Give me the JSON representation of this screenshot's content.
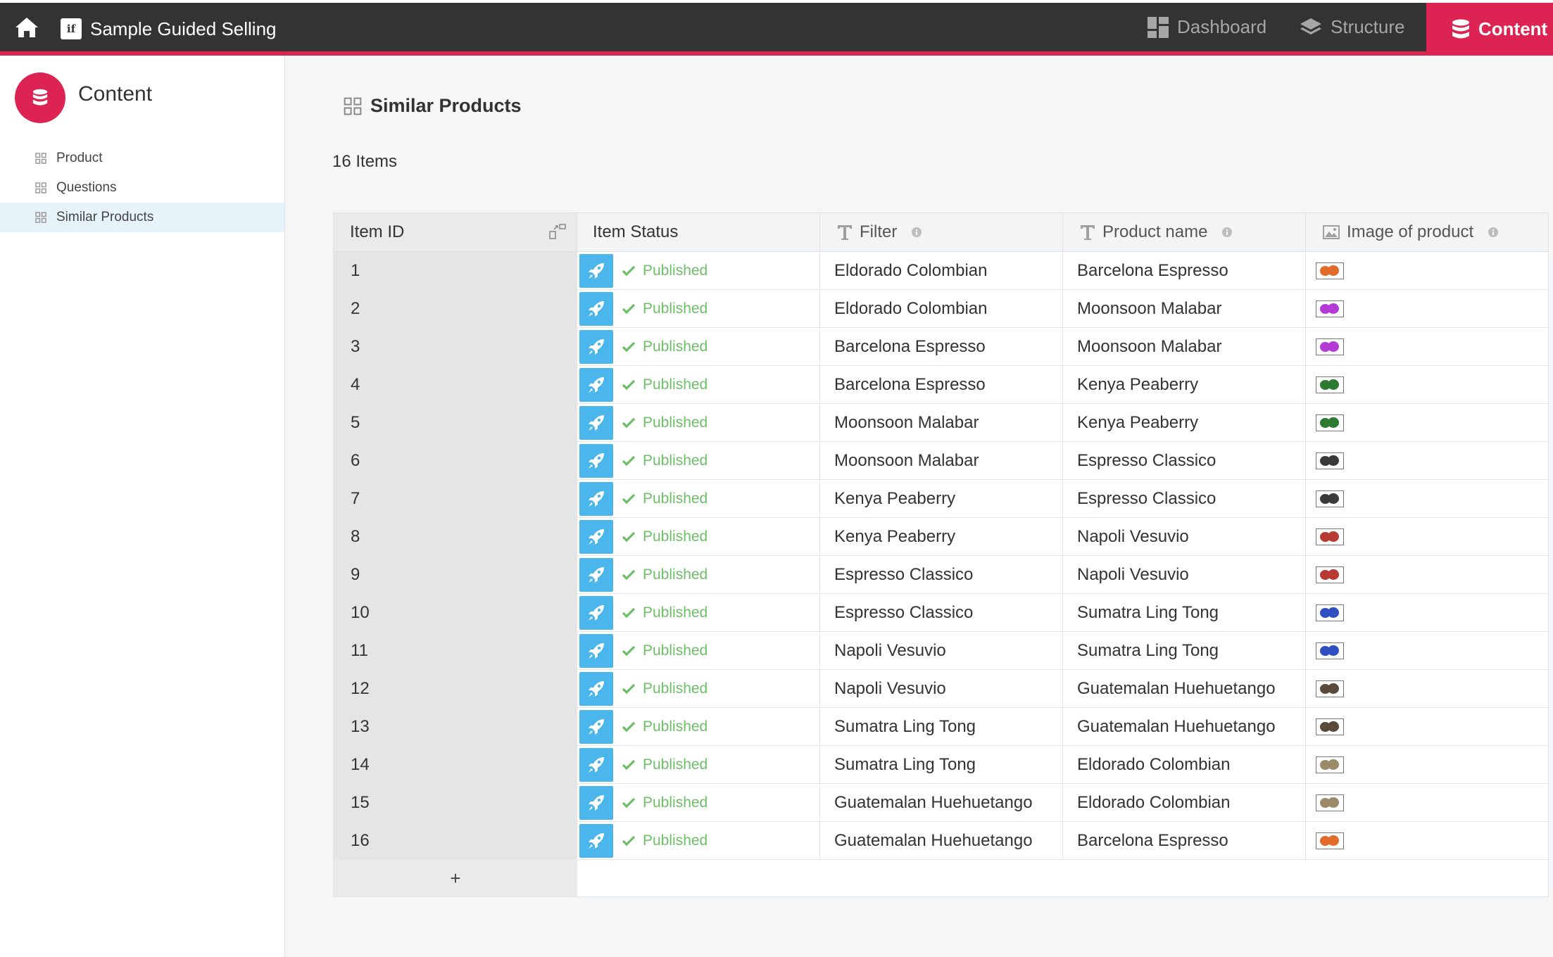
{
  "app": {
    "title": "Sample Guided Selling",
    "logo_text": "if",
    "brand_color": "#dc2351"
  },
  "topnav": {
    "dashboard": "Dashboard",
    "structure": "Structure",
    "content": "Content"
  },
  "sidebar": {
    "title": "Content",
    "items": [
      {
        "label": "Product",
        "active": false
      },
      {
        "label": "Questions",
        "active": false
      },
      {
        "label": "Similar Products",
        "active": true
      }
    ]
  },
  "main": {
    "title": "Similar Products",
    "count": "16 Items"
  },
  "table": {
    "headers": {
      "id": "Item ID",
      "status": "Item Status",
      "filter": "Filter",
      "product": "Product name",
      "image": "Image of product"
    },
    "add_label": "+",
    "rows": [
      {
        "id": "1",
        "status": "Published",
        "filter": "Eldorado Colombian",
        "product": "Barcelona Espresso",
        "color": "#e06a2a"
      },
      {
        "id": "2",
        "status": "Published",
        "filter": "Eldorado Colombian",
        "product": "Moonsoon Malabar",
        "color": "#b43ad6"
      },
      {
        "id": "3",
        "status": "Published",
        "filter": "Barcelona Espresso",
        "product": "Moonsoon Malabar",
        "color": "#b43ad6"
      },
      {
        "id": "4",
        "status": "Published",
        "filter": "Barcelona Espresso",
        "product": "Kenya Peaberry",
        "color": "#2f7a33"
      },
      {
        "id": "5",
        "status": "Published",
        "filter": "Moonsoon Malabar",
        "product": "Kenya Peaberry",
        "color": "#2f7a33"
      },
      {
        "id": "6",
        "status": "Published",
        "filter": "Moonsoon Malabar",
        "product": "Espresso Classico",
        "color": "#3a3a3a"
      },
      {
        "id": "7",
        "status": "Published",
        "filter": "Kenya Peaberry",
        "product": "Espresso Classico",
        "color": "#3a3a3a"
      },
      {
        "id": "8",
        "status": "Published",
        "filter": "Kenya Peaberry",
        "product": "Napoli Vesuvio",
        "color": "#b83a35"
      },
      {
        "id": "9",
        "status": "Published",
        "filter": "Espresso Classico",
        "product": "Napoli Vesuvio",
        "color": "#b83a35"
      },
      {
        "id": "10",
        "status": "Published",
        "filter": "Espresso Classico",
        "product": "Sumatra Ling Tong",
        "color": "#2f4fc0"
      },
      {
        "id": "11",
        "status": "Published",
        "filter": "Napoli Vesuvio",
        "product": "Sumatra Ling Tong",
        "color": "#2f4fc0"
      },
      {
        "id": "12",
        "status": "Published",
        "filter": "Napoli Vesuvio",
        "product": "Guatemalan Huehuetango",
        "color": "#5a4a3a"
      },
      {
        "id": "13",
        "status": "Published",
        "filter": "Sumatra Ling Tong",
        "product": "Guatemalan Huehuetango",
        "color": "#5a4a3a"
      },
      {
        "id": "14",
        "status": "Published",
        "filter": "Sumatra Ling Tong",
        "product": "Eldorado Colombian",
        "color": "#9a8a68"
      },
      {
        "id": "15",
        "status": "Published",
        "filter": "Guatemalan Huehuetango",
        "product": "Eldorado Colombian",
        "color": "#9a8a68"
      },
      {
        "id": "16",
        "status": "Published",
        "filter": "Guatemalan Huehuetango",
        "product": "Barcelona Espresso",
        "color": "#e06a2a"
      }
    ]
  }
}
